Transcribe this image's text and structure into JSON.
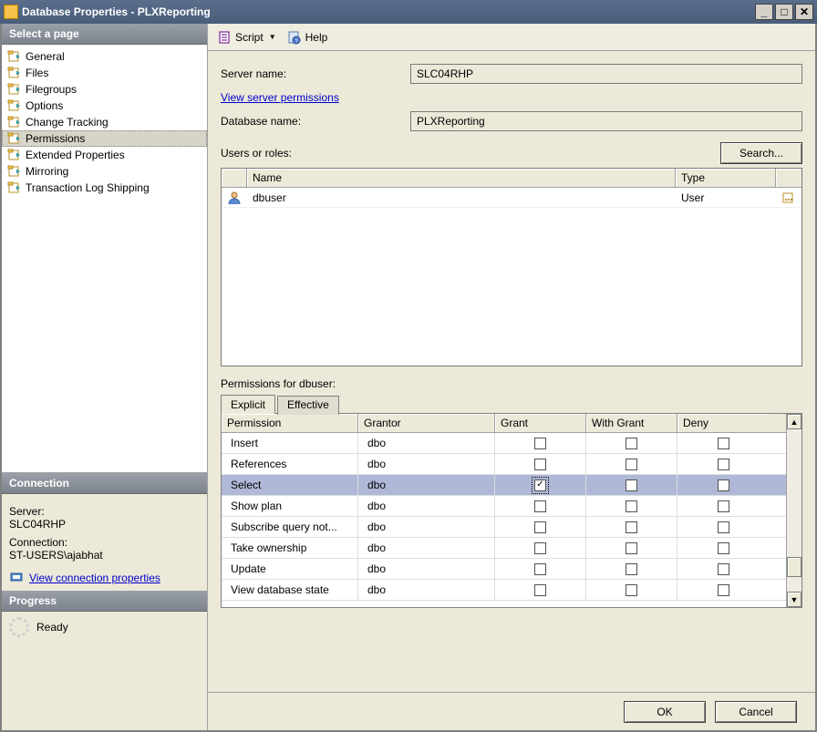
{
  "window": {
    "title": "Database Properties - PLXReporting"
  },
  "sidebar": {
    "header": "Select a page",
    "items": [
      {
        "label": "General",
        "selected": false
      },
      {
        "label": "Files",
        "selected": false
      },
      {
        "label": "Filegroups",
        "selected": false
      },
      {
        "label": "Options",
        "selected": false
      },
      {
        "label": "Change Tracking",
        "selected": false
      },
      {
        "label": "Permissions",
        "selected": true
      },
      {
        "label": "Extended Properties",
        "selected": false
      },
      {
        "label": "Mirroring",
        "selected": false
      },
      {
        "label": "Transaction Log Shipping",
        "selected": false
      }
    ]
  },
  "connection": {
    "header": "Connection",
    "server_label": "Server:",
    "server_value": "SLC04RHP",
    "conn_label": "Connection:",
    "conn_value": "ST-USERS\\ajabhat",
    "view_link": "View connection properties"
  },
  "progress": {
    "header": "Progress",
    "status": "Ready"
  },
  "toolbar": {
    "script": "Script",
    "help": "Help"
  },
  "main": {
    "server_name_label": "Server name:",
    "server_name_value": "SLC04RHP",
    "view_server_perm": "View server permissions",
    "db_name_label": "Database name:",
    "db_name_value": "PLXReporting",
    "users_label": "Users or roles:",
    "search_btn": "Search...",
    "grid_headers": {
      "name": "Name",
      "type": "Type"
    },
    "user_rows": [
      {
        "name": "dbuser",
        "type": "User"
      }
    ],
    "perm_for_label": "Permissions for dbuser:",
    "tabs": {
      "explicit": "Explicit",
      "effective": "Effective"
    },
    "perm_headers": {
      "permission": "Permission",
      "grantor": "Grantor",
      "grant": "Grant",
      "with_grant": "With Grant",
      "deny": "Deny"
    },
    "perm_rows": [
      {
        "permission": "Insert",
        "grantor": "dbo",
        "grant": false,
        "with_grant": false,
        "deny": false,
        "selected": false
      },
      {
        "permission": "References",
        "grantor": "dbo",
        "grant": false,
        "with_grant": false,
        "deny": false,
        "selected": false
      },
      {
        "permission": "Select",
        "grantor": "dbo",
        "grant": true,
        "with_grant": false,
        "deny": false,
        "selected": true
      },
      {
        "permission": "Show plan",
        "grantor": "dbo",
        "grant": false,
        "with_grant": false,
        "deny": false,
        "selected": false
      },
      {
        "permission": "Subscribe query not...",
        "grantor": "dbo",
        "grant": false,
        "with_grant": false,
        "deny": false,
        "selected": false
      },
      {
        "permission": "Take ownership",
        "grantor": "dbo",
        "grant": false,
        "with_grant": false,
        "deny": false,
        "selected": false
      },
      {
        "permission": "Update",
        "grantor": "dbo",
        "grant": false,
        "with_grant": false,
        "deny": false,
        "selected": false
      },
      {
        "permission": "View database state",
        "grantor": "dbo",
        "grant": false,
        "with_grant": false,
        "deny": false,
        "selected": false
      }
    ]
  },
  "footer": {
    "ok": "OK",
    "cancel": "Cancel"
  }
}
